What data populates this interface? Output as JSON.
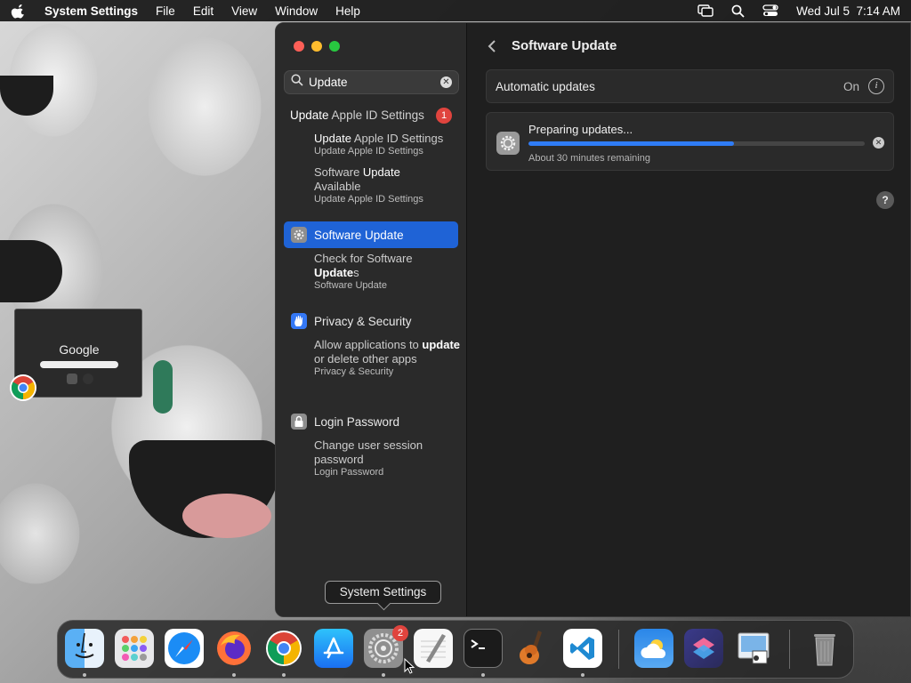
{
  "menubar": {
    "app_name": "System Settings",
    "menus": [
      "File",
      "Edit",
      "View",
      "Window",
      "Help"
    ],
    "datetime": "Wed Jul 5  7:14 AM"
  },
  "desktop": {
    "thumbnail_logo": "Google"
  },
  "sidebar": {
    "search_value": "Update",
    "group_header": {
      "bold": "Update",
      "rest": " Apple ID Settings",
      "badge": "1"
    },
    "results": [
      {
        "line_bold": "Update",
        "line_rest": " Apple ID Settings",
        "caption": "Update Apple ID Settings"
      },
      {
        "line_pre": "Software ",
        "line_bold": "Update",
        "line_rest": " Available",
        "caption": "Update Apple ID Settings"
      }
    ],
    "software_update": {
      "pre": "Software ",
      "bold": "Update"
    },
    "software_update_result": {
      "pre": "Check for Software ",
      "bold": "Update",
      "rest": "s",
      "caption": "Software Update"
    },
    "privacy": {
      "label": "Privacy & Security"
    },
    "privacy_result": {
      "pre": "Allow applications to ",
      "bold": "update",
      "rest": " or delete other apps",
      "caption": "Privacy & Security"
    },
    "login": {
      "label": "Login Password"
    },
    "login_result": {
      "text": "Change user session password",
      "caption": "Login Password"
    }
  },
  "content": {
    "title": "Software Update",
    "automatic_label": "Automatic updates",
    "automatic_value": "On",
    "progress_title": "Preparing updates...",
    "progress_fraction": 0.61,
    "progress_remaining": "About 30 minutes remaining",
    "help": "?"
  },
  "tooltip": {
    "text": "System Settings"
  },
  "dock": {
    "settings_badge": "2",
    "apps": [
      "Finder",
      "Launchpad",
      "Safari",
      "Firefox",
      "Google Chrome",
      "App Store",
      "System Settings",
      "TextEdit",
      "Terminal",
      "GarageBand",
      "Visual Studio Code",
      "Weather",
      "Shortcuts",
      "Preview",
      "Trash"
    ]
  },
  "colors": {
    "accent": "#1f63d6",
    "progress": "#2f7cf6",
    "badge": "#e0443e"
  }
}
